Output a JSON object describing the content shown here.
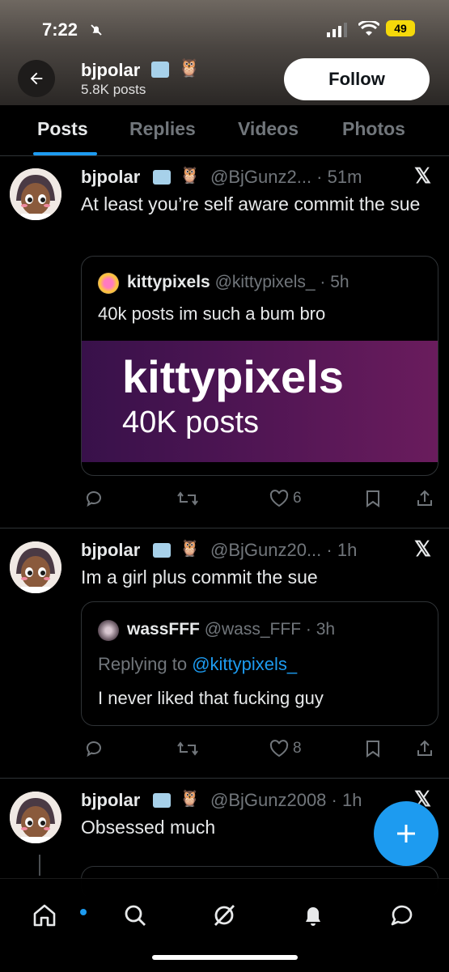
{
  "status_bar": {
    "time": "7:22",
    "battery": "49"
  },
  "header": {
    "name": "bjpolar",
    "posts_count": "5.8K posts",
    "follow_label": "Follow",
    "badge_emoji": "🦉"
  },
  "tabs": [
    "Posts",
    "Replies",
    "Videos",
    "Photos"
  ],
  "posts": [
    {
      "name": "bjpolar",
      "handle": "@BjGunz2... · 51m",
      "text": "At least you’re self aware commit the sue",
      "quote": {
        "name": "kittypixels",
        "handle": "@kittypixels_ · 5h",
        "text": "40k posts im such a bum bro",
        "image_title": "kittypixels",
        "image_subtitle": "40K posts"
      },
      "likes": "6"
    },
    {
      "name": "bjpolar",
      "handle": "@BjGunz20... · 1h",
      "text": "Im a girl plus commit the sue",
      "quote": {
        "name": "wassFFF",
        "handle": "@wass_FFF · 3h",
        "replying_prefix": "Replying to ",
        "replying_to": "@kittypixels_",
        "text": "I never liked that fucking guy"
      },
      "likes": "8"
    },
    {
      "name": "bjpolar",
      "handle": "@BjGunz2008 · 1h",
      "text": "Obsessed much"
    }
  ],
  "icons": {
    "back": "arrow-left-icon",
    "x_logo": "x-logo-icon",
    "reply": "comment-icon",
    "repost": "repost-icon",
    "like": "heart-icon",
    "bookmark": "bookmark-icon",
    "share": "share-icon",
    "compose": "plus-icon",
    "nav": [
      "home-icon",
      "search-icon",
      "grok-icon",
      "notifications-icon",
      "messages-icon"
    ]
  },
  "colors": {
    "accent": "#1d9bf0",
    "background": "#000000",
    "muted": "#71767b"
  }
}
